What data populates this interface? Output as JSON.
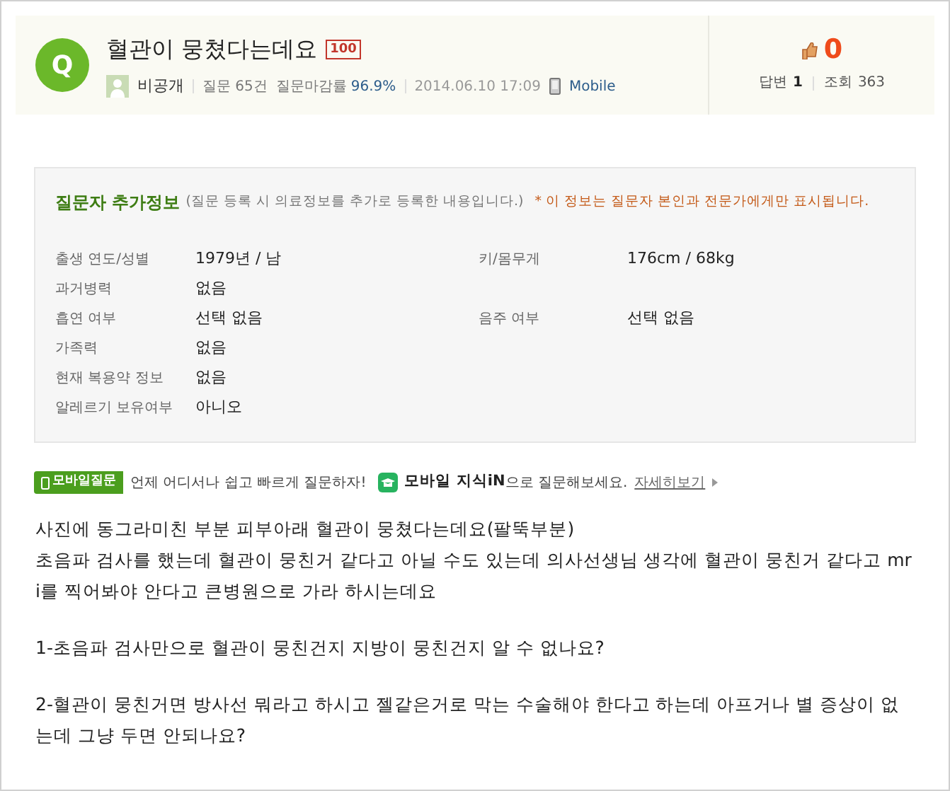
{
  "question": {
    "badge": "Q",
    "title": "혈관이 뭉쳤다는데요",
    "points": "100",
    "author": "비공개",
    "question_count": "질문 65건",
    "close_rate_label": "질문마감률",
    "close_rate": "96.9%",
    "date": "2014.06.10 17:09",
    "device": "Mobile",
    "likes": "0",
    "answers_label": "답변",
    "answers": "1",
    "views_label": "조회",
    "views": "363"
  },
  "extra_info": {
    "title": "질문자 추가정보",
    "subtitle": "(질문 등록 시 의료정보를 추가로 등록한 내용입니다.)",
    "notice": "* 이 정보는 질문자 본인과 전문가에게만 표시됩니다.",
    "rows": [
      {
        "label": "출생 연도/성별",
        "value": "1979년 / 남",
        "label_2": "키/몸무게",
        "value_2": "176cm / 68kg"
      },
      {
        "label": "과거병력",
        "value": "없음"
      },
      {
        "label": "흡연 여부",
        "value": "선택 없음",
        "label_2": "음주 여부",
        "value_2": "선택 없음"
      },
      {
        "label": "가족력",
        "value": "없음"
      },
      {
        "label": "현재 복용약 정보",
        "value": "없음"
      },
      {
        "label": "알레르기 보유여부",
        "value": "아니오"
      }
    ]
  },
  "mobile_promo": {
    "tag": "모바일질문",
    "text": "언제 어디서나 쉽고 빠르게 질문하자!",
    "app_name": "모바일 지식iN",
    "text_2": "으로 질문해보세요.",
    "link": "자세히보기"
  },
  "body": [
    "사진에 동그라미친 부분 피부아래 혈관이 뭉쳤다는데요(팔뚝부분)\n초음파 검사를 했는데 혈관이 뭉친거 같다고 아닐 수도 있는데 의사선생님 생각에 혈관이 뭉친거 같다고 mri를 찍어봐야 안다고 큰병원으로 가라 하시는데요",
    "1-초음파 검사만으로 혈관이 뭉친건지 지방이 뭉친건지 알 수 없나요?",
    "2-혈관이 뭉친거면 방사선 뭐라고 하시고 젤같은거로 막는 수술해야 한다고 하는데 아프거나 별 증상이 없는데 그냥 두면 안되나요?"
  ]
}
